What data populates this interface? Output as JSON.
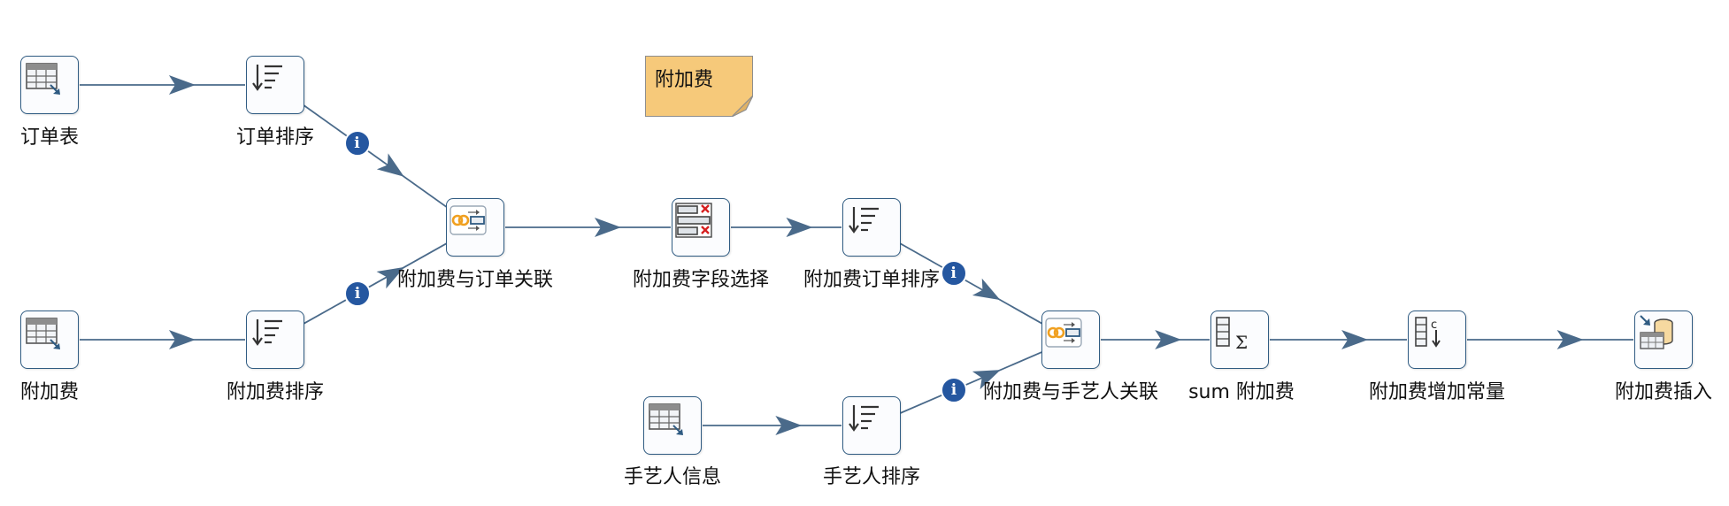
{
  "colors": {
    "hop_line": "#4a6a8a",
    "step_border": "#2f5b82",
    "info_badge": "#2557a0",
    "note_fill": "#f6c97a",
    "join_orange": "#f0a020"
  },
  "note": {
    "text": "附加费"
  },
  "steps": [
    {
      "id": "s1",
      "name": "step-order-table",
      "label": "订单表",
      "icon": "table-input-icon"
    },
    {
      "id": "s2",
      "name": "step-order-sort",
      "label": "订单排序",
      "icon": "sort-rows-icon"
    },
    {
      "id": "s3",
      "name": "step-surcharge-input",
      "label": "附加费",
      "icon": "table-input-icon"
    },
    {
      "id": "s4",
      "name": "step-surcharge-sort",
      "label": "附加费排序",
      "icon": "sort-rows-icon"
    },
    {
      "id": "s5",
      "name": "step-surcharge-order-join",
      "label": "附加费与订单关联",
      "icon": "merge-join-icon"
    },
    {
      "id": "s6",
      "name": "step-surcharge-field-select",
      "label": "附加费字段选择",
      "icon": "select-values-icon"
    },
    {
      "id": "s7",
      "name": "step-surcharge-order-sort",
      "label": "附加费订单排序",
      "icon": "sort-rows-icon"
    },
    {
      "id": "s8",
      "name": "step-craftsman-info",
      "label": "手艺人信息",
      "icon": "table-input-icon"
    },
    {
      "id": "s9",
      "name": "step-craftsman-sort",
      "label": "手艺人排序",
      "icon": "sort-rows-icon"
    },
    {
      "id": "s10",
      "name": "step-surcharge-craftsman-join",
      "label": "附加费与手艺人关联",
      "icon": "merge-join-icon"
    },
    {
      "id": "s11",
      "name": "step-sum-surcharge",
      "label": "sum 附加费",
      "icon": "group-by-sum-icon"
    },
    {
      "id": "s12",
      "name": "step-add-constants",
      "label": "附加费增加常量",
      "icon": "add-constants-icon"
    },
    {
      "id": "s13",
      "name": "step-surcharge-insert",
      "label": "附加费插入",
      "icon": "table-output-icon"
    }
  ],
  "hops": [
    {
      "from": "s1",
      "to": "s2",
      "info": false
    },
    {
      "from": "s2",
      "to": "s5",
      "info": true
    },
    {
      "from": "s3",
      "to": "s4",
      "info": false
    },
    {
      "from": "s4",
      "to": "s5",
      "info": true
    },
    {
      "from": "s5",
      "to": "s6",
      "info": false
    },
    {
      "from": "s6",
      "to": "s7",
      "info": false
    },
    {
      "from": "s7",
      "to": "s10",
      "info": true
    },
    {
      "from": "s8",
      "to": "s9",
      "info": false
    },
    {
      "from": "s9",
      "to": "s10",
      "info": true
    },
    {
      "from": "s10",
      "to": "s11",
      "info": false
    },
    {
      "from": "s11",
      "to": "s12",
      "info": false
    },
    {
      "from": "s12",
      "to": "s13",
      "info": false
    }
  ]
}
